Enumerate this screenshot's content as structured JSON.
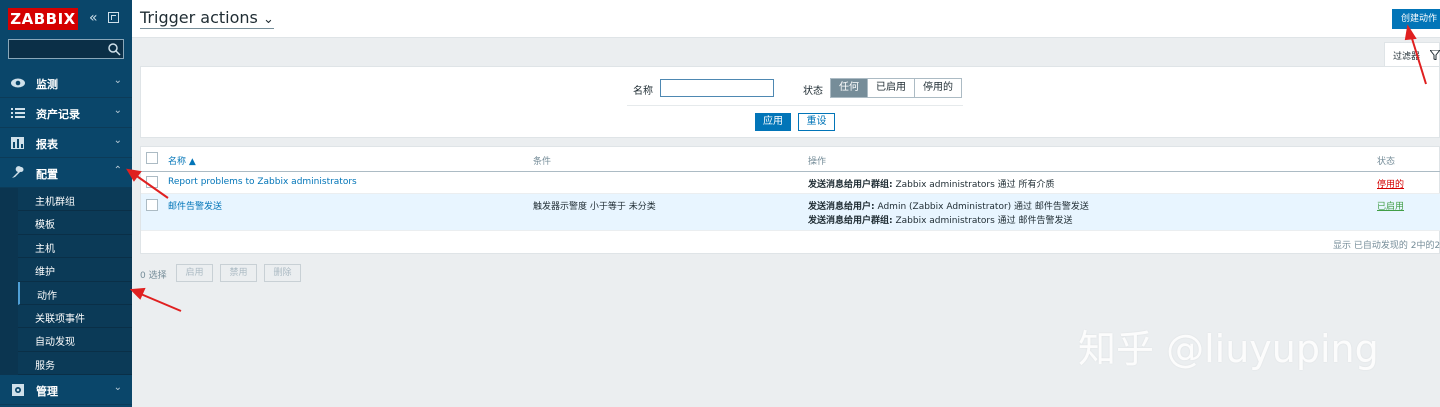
{
  "brand": {
    "logo_text": "ZABBIX",
    "logo_color": "#d40000",
    "sidebar_color": "#0a466a"
  },
  "sidebar": {
    "search_placeholder": "",
    "menu": [
      {
        "label": "监测",
        "icon": "eye-icon"
      },
      {
        "label": "资产记录",
        "icon": "list-icon"
      },
      {
        "label": "报表",
        "icon": "bar-chart-icon"
      },
      {
        "label": "配置",
        "icon": "wrench-icon",
        "open": true
      },
      {
        "label": "管理",
        "icon": "gear-icon"
      }
    ],
    "submenu": [
      {
        "label": "主机群组"
      },
      {
        "label": "模板"
      },
      {
        "label": "主机"
      },
      {
        "label": "维护"
      },
      {
        "label": "动作",
        "selected": true
      },
      {
        "label": "关联项事件"
      },
      {
        "label": "自动发现"
      },
      {
        "label": "服务"
      }
    ]
  },
  "header": {
    "title": "Trigger actions",
    "create_button": "创建动作"
  },
  "filter": {
    "tab_label": "过滤器",
    "name_label": "名称",
    "name_value": "",
    "status_label": "状态",
    "status_options": [
      "任何",
      "已启用",
      "停用的"
    ],
    "status_selected": "任何",
    "apply": "应用",
    "reset": "重设"
  },
  "table": {
    "columns": {
      "name": "名称 ▲",
      "conditions": "条件",
      "operations": "操作",
      "status": "状态"
    },
    "rows": [
      {
        "name": "Report problems to Zabbix administrators",
        "conditions": "",
        "ops": [
          {
            "bold": "发送消息给用户群组:",
            "text": " Zabbix administrators 通过 所有介质"
          }
        ],
        "status": "停用的"
      },
      {
        "name": "邮件告警发送",
        "conditions": "触发器示警度 小于等于 未分类",
        "ops": [
          {
            "bold": "发送消息给用户:",
            "text": " Admin (Zabbix Administrator) 通过 邮件告警发送"
          },
          {
            "bold": "发送消息给用户群组:",
            "text": " Zabbix administrators 通过 邮件告警发送"
          }
        ],
        "status": "已启用"
      }
    ],
    "footer": "显示 已自动发现的 2中的2"
  },
  "mass_actions": {
    "selected": "0 选择",
    "enable": "启用",
    "disable": "禁用",
    "delete": "删除"
  },
  "watermark": "知乎 @liuyuping"
}
